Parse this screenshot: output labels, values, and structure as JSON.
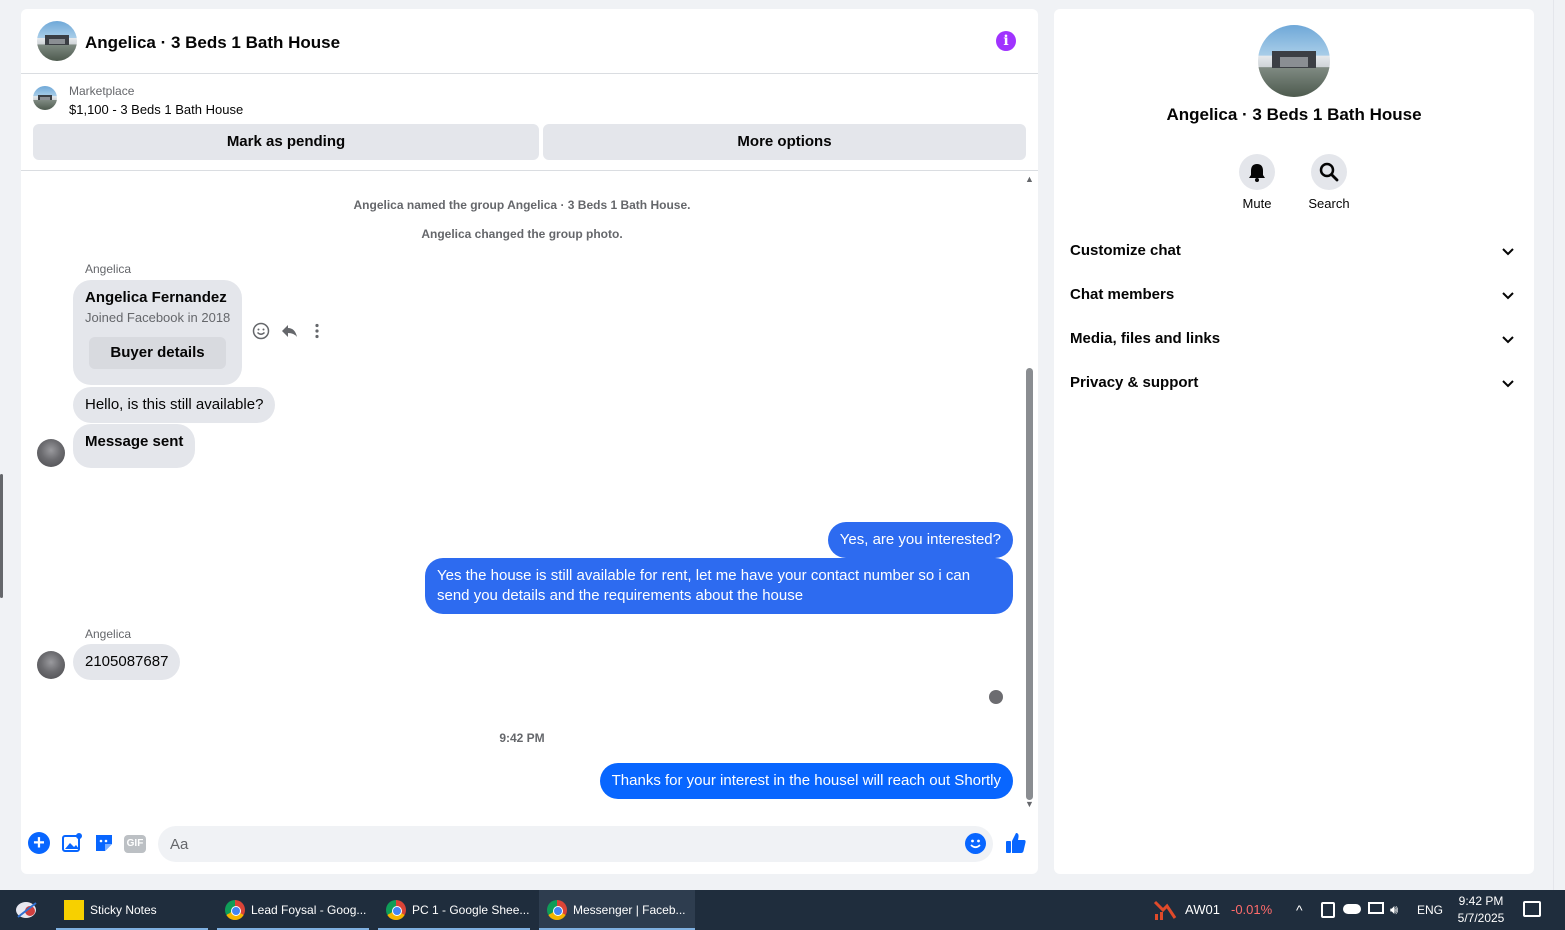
{
  "chat": {
    "title": "Angelica · 3 Beds 1 Bath House",
    "listing": {
      "source": "Marketplace",
      "price_title": "$1,100 - 3 Beds 1 Bath House",
      "pending_label": "Mark as pending",
      "more_label": "More options"
    },
    "system_messages": [
      "Angelica named the group Angelica · 3 Beds 1 Bath House.",
      "Angelica changed the group photo."
    ],
    "buyer_card": {
      "sender": "Angelica",
      "name": "Angelica Fernandez",
      "joined": "Joined Facebook in 2018",
      "button": "Buyer details"
    },
    "incoming_1": "Hello, is this still available?",
    "incoming_2": "Message sent",
    "outgoing_1": "Yes, are you interested?",
    "outgoing_2": "Yes the house is still available for rent, let me have your contact number so i can send you details and the requirements about the house",
    "incoming_3_sender": "Angelica",
    "incoming_3": "2105087687",
    "timestamp": "9:42 PM",
    "outgoing_3": "Thanks for your interest in the housel will reach out Shortly",
    "composer": {
      "placeholder": "Aa",
      "gif_label": "GIF"
    }
  },
  "info_panel": {
    "title": "Angelica · 3 Beds 1 Bath House",
    "mute_label": "Mute",
    "search_label": "Search",
    "sections": [
      "Customize chat",
      "Chat members",
      "Media, files and links",
      "Privacy & support"
    ]
  },
  "taskbar": {
    "items": [
      "Sticky Notes",
      "Lead Foysal - Goog...",
      "PC 1 - Google Shee...",
      "Messenger | Faceb..."
    ],
    "stock_symbol": "AW01",
    "stock_change": "-0.01%",
    "language": "ENG",
    "time": "9:42 PM",
    "date": "5/7/2025"
  },
  "colors": {
    "accent": "#0866ff",
    "outgoing_bubble": "#2d6bf0",
    "info_icon": "#a033ff",
    "taskbar": "#1f2d3d"
  }
}
